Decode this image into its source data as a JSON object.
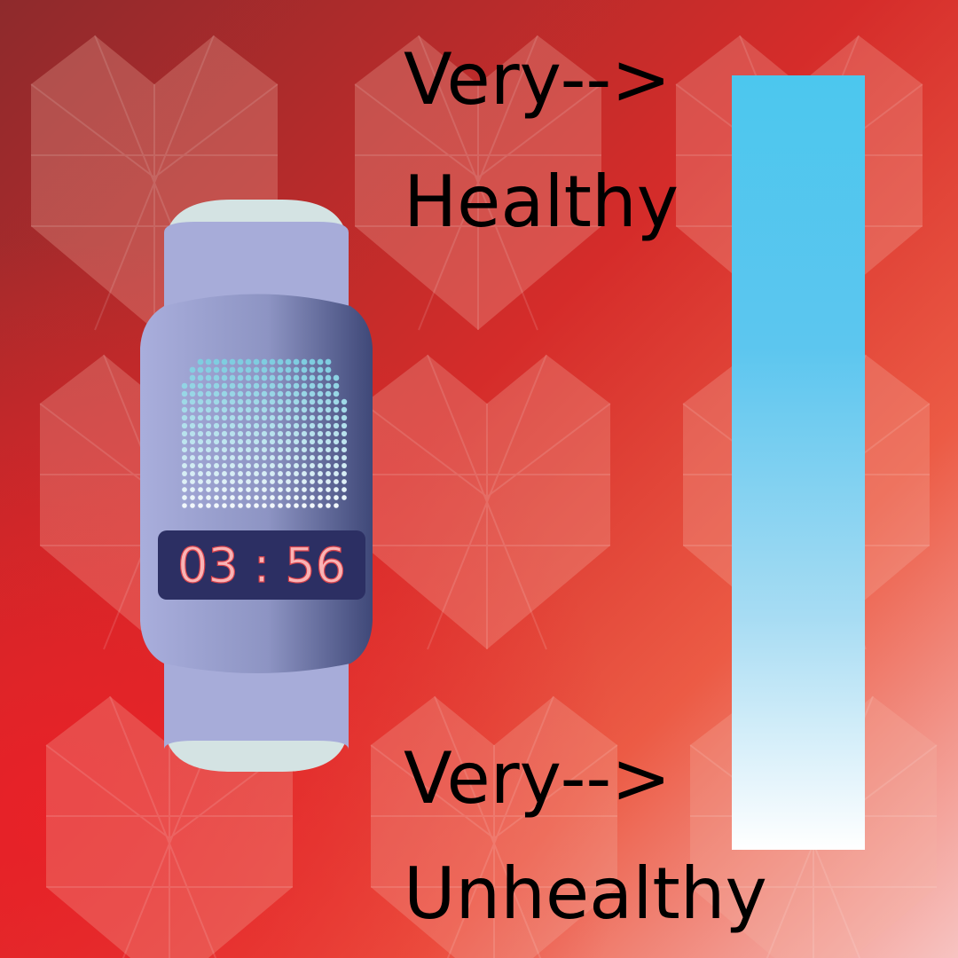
{
  "watch": {
    "time": "03 : 56"
  },
  "scale": {
    "top_label_line1": "Very-->",
    "top_label_line2": "Healthy",
    "bottom_label_line1": "Very-->",
    "bottom_label_line2": "Unhealthy"
  },
  "colors": {
    "background_dark": "#8e2a2c",
    "background_red": "#e62227",
    "background_light": "#f4b5b3",
    "bar_top": "#4cc7ee",
    "bar_bottom": "#ffffff",
    "watch_body": "#a7acd9",
    "watch_strap": "#d4e3e3",
    "watch_screen_dark": "#3d4775",
    "time_panel": "#2c2f63",
    "time_text": "#f9b4b5",
    "heart_dots_top": "#7fcde0",
    "heart_dots_bottom": "#f2f8fb"
  },
  "icons": {
    "background": "faceted-heart-pattern",
    "watch_display": "dotted-heart-icon"
  }
}
